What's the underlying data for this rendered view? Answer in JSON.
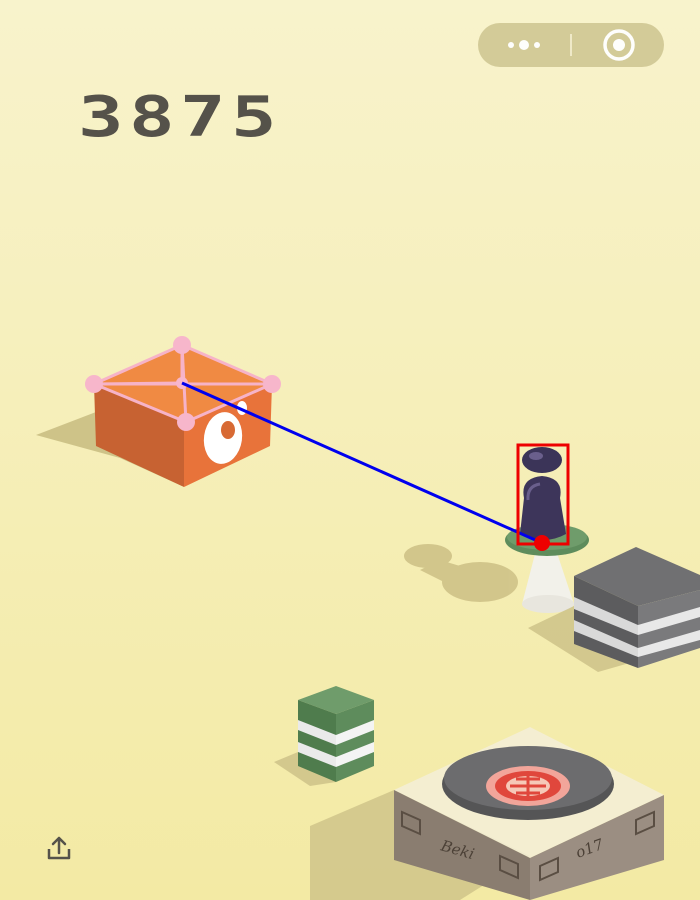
{
  "game": {
    "score": "3875",
    "engraving_left": "Beki",
    "engraving_right": "o17"
  },
  "hud": {
    "menu_icon": "more-dots-icon",
    "close_icon": "target-circle-icon",
    "share_icon": "share-upload-icon"
  },
  "colors": {
    "background_top": "#f8f3c9",
    "background_bottom": "#f3eaa0",
    "capsule": "#d2c996",
    "score_text": "#55524a",
    "orange_block": "#f07e3a",
    "dark_block": "#6e6e70",
    "green_block": "#5e8c5c",
    "wood_block": "#8c7f73",
    "player": "#3b3458",
    "trajectory_line": "#0000ee",
    "target_box": "#ee0000",
    "keypoints": "#f6b3c8"
  }
}
